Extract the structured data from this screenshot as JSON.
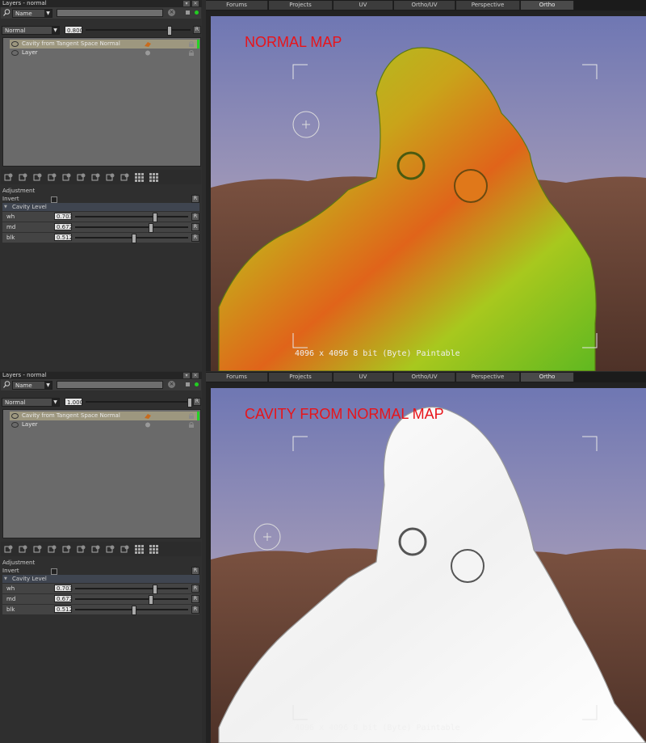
{
  "panels": [
    {
      "layers_title": "Layers - normal",
      "search_mode": "Name",
      "blend_mode": "Normal",
      "opacity": "0.800",
      "opacity_fraction": 0.8,
      "layers": [
        {
          "name": "Cavity from Tangent Space Normal",
          "selected": true
        },
        {
          "name": "Layer",
          "selected": false
        }
      ],
      "adjustment": {
        "header": "Adjustment",
        "invert_label": "Invert",
        "group_label": "Cavity Level",
        "reset_label": "R",
        "params": [
          {
            "label": "wh",
            "value": "0.703",
            "fraction": 0.703
          },
          {
            "label": "md",
            "value": "0.672",
            "fraction": 0.672
          },
          {
            "label": "blk",
            "value": "0.512",
            "fraction": 0.512
          }
        ]
      },
      "tabs": [
        "Forums",
        "Projects",
        "UV",
        "Ortho/UV",
        "Perspective",
        "Ortho"
      ],
      "active_tab": "Ortho",
      "viewport_label": "NORMAL MAP",
      "resolution_text": "4096 x 4096 8 bit (Byte) Paintable",
      "mode": "normal"
    },
    {
      "layers_title": "Layers - normal",
      "search_mode": "Name",
      "blend_mode": "Normal",
      "opacity": "1.000",
      "opacity_fraction": 1.0,
      "layers": [
        {
          "name": "Cavity from Tangent Space Normal",
          "selected": true
        },
        {
          "name": "Layer",
          "selected": false
        }
      ],
      "adjustment": {
        "header": "Adjustment",
        "invert_label": "Invert",
        "group_label": "Cavity Level",
        "reset_label": "R",
        "params": [
          {
            "label": "wh",
            "value": "0.703",
            "fraction": 0.703
          },
          {
            "label": "md",
            "value": "0.672",
            "fraction": 0.672
          },
          {
            "label": "blk",
            "value": "0.512",
            "fraction": 0.512
          }
        ]
      },
      "tabs": [
        "Forums",
        "Projects",
        "UV",
        "Ortho/UV",
        "Perspective",
        "Ortho"
      ],
      "active_tab": "Ortho",
      "viewport_label": "CAVITY FROM NORMAL MAP",
      "resolution_text": "4096 x 4096 8 bit (Byte) Paintable",
      "mode": "cavity"
    }
  ],
  "colors": {
    "label_red": "#e8141a",
    "selected_layer": "#9d977f",
    "layer_active_bar": "#26d226",
    "status_dot": "#22cc22"
  },
  "icons": [
    "search-icon",
    "chevron-down-icon",
    "clear-icon",
    "eye-icon",
    "fx-icon",
    "lock-icon",
    "minimize-icon",
    "close-icon",
    "crosshair-icon"
  ]
}
